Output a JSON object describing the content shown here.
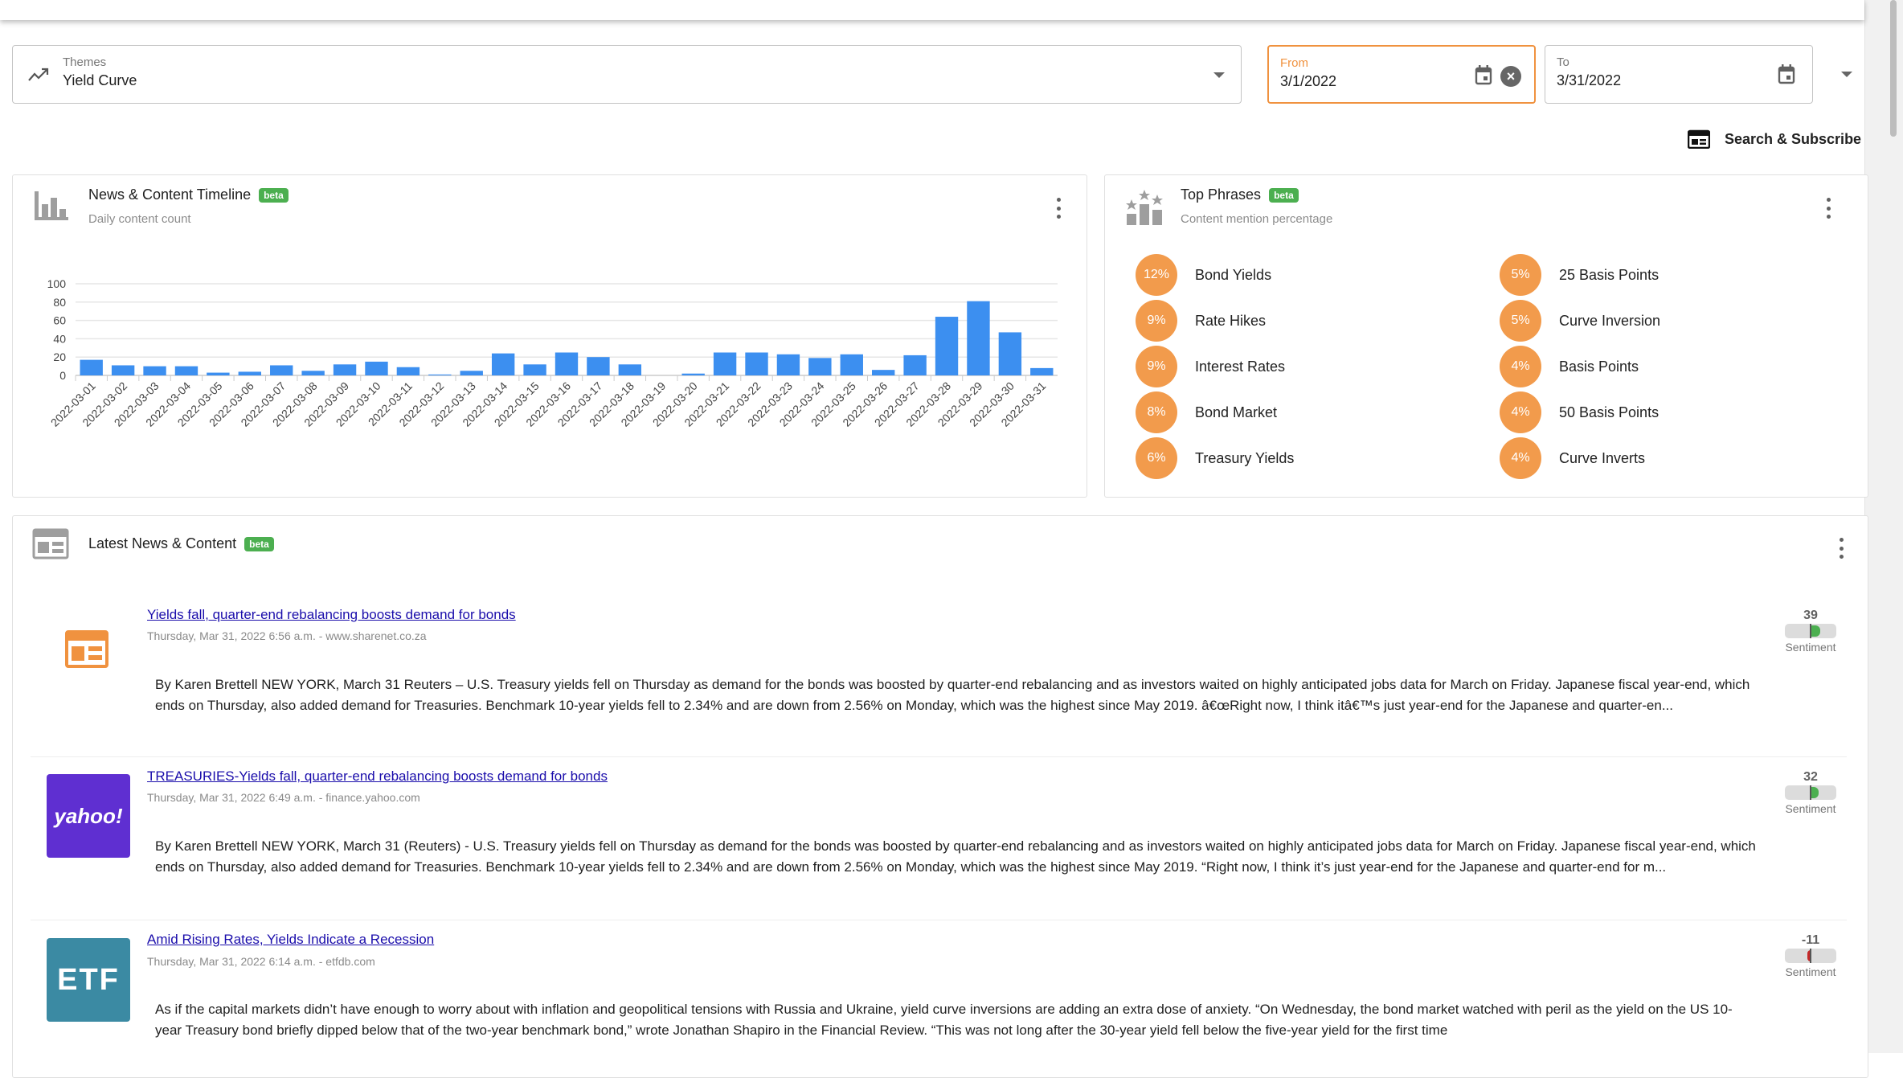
{
  "filters": {
    "themes": {
      "label": "Themes",
      "value": "Yield Curve"
    },
    "from": {
      "label": "From",
      "value": "3/1/2022"
    },
    "to": {
      "label": "To",
      "value": "3/31/2022"
    }
  },
  "search_subscribe_label": "Search & Subscribe",
  "beta_label": "beta",
  "timeline": {
    "title": "News & Content Timeline",
    "subtitle": "Daily content count"
  },
  "chart_data": {
    "type": "bar",
    "title": "News & Content Timeline",
    "subtitle": "Daily content count",
    "xlabel": "",
    "ylabel": "",
    "ylim": [
      0,
      100
    ],
    "yticks": [
      0,
      20,
      40,
      60,
      80,
      100
    ],
    "grid": true,
    "color": "#3c8ff0",
    "categories": [
      "2022-03-01",
      "2022-03-02",
      "2022-03-03",
      "2022-03-04",
      "2022-03-05",
      "2022-03-06",
      "2022-03-07",
      "2022-03-08",
      "2022-03-09",
      "2022-03-10",
      "2022-03-11",
      "2022-03-12",
      "2022-03-13",
      "2022-03-14",
      "2022-03-15",
      "2022-03-16",
      "2022-03-17",
      "2022-03-18",
      "2022-03-19",
      "2022-03-20",
      "2022-03-21",
      "2022-03-22",
      "2022-03-23",
      "2022-03-24",
      "2022-03-25",
      "2022-03-26",
      "2022-03-27",
      "2022-03-28",
      "2022-03-29",
      "2022-03-30",
      "2022-03-31"
    ],
    "values": [
      17,
      11,
      10,
      10,
      3,
      4,
      11,
      5,
      12,
      15,
      9,
      1,
      5,
      24,
      12,
      25,
      20,
      12,
      0,
      2,
      25,
      25,
      23,
      19,
      23,
      6,
      22,
      64,
      81,
      47,
      8
    ]
  },
  "phrases": {
    "title": "Top Phrases",
    "subtitle": "Content mention percentage",
    "left": [
      {
        "pct": "12%",
        "label": "Bond Yields"
      },
      {
        "pct": "9%",
        "label": "Rate Hikes"
      },
      {
        "pct": "9%",
        "label": "Interest Rates"
      },
      {
        "pct": "8%",
        "label": "Bond Market"
      },
      {
        "pct": "6%",
        "label": "Treasury Yields"
      }
    ],
    "right": [
      {
        "pct": "5%",
        "label": "25 Basis Points"
      },
      {
        "pct": "5%",
        "label": "Curve Inversion"
      },
      {
        "pct": "4%",
        "label": "Basis Points"
      },
      {
        "pct": "4%",
        "label": "50 Basis Points"
      },
      {
        "pct": "4%",
        "label": "Curve Inverts"
      }
    ]
  },
  "news": {
    "title": "Latest News & Content",
    "sentiment_label": "Sentiment",
    "items": [
      {
        "title": "Yields fall, quarter-end rebalancing boosts demand for bonds",
        "meta": "Thursday, Mar 31, 2022 6:56 a.m. - www.sharenet.co.za",
        "source_icon": "newspaper-icon",
        "body": "By Karen Brettell NEW YORK, March 31  Reuters  – U.S. Treasury yields fell on Thursday as demand for the bonds was boosted by quarter-end rebalancing and as investors waited on highly anticipated jobs data for March on Friday. Japanese fiscal year-end, which ends on Thursday, also added demand for Treasuries. Benchmark 10-year yields fell to 2.34% and are down from 2.56% on Monday, which was the highest since May 2019. â€œRight now, I think itâ€™s just year-end for the Japanese and quarter-en...",
        "sentiment": 39
      },
      {
        "title": "TREASURIES-Yields fall, quarter-end rebalancing boosts demand for bonds",
        "meta": "Thursday, Mar 31, 2022 6:49 a.m. - finance.yahoo.com",
        "source_logo_text": "yahoo!",
        "body": "By Karen Brettell NEW YORK, March 31 (Reuters) - U.S. Treasury yields fell on Thursday as demand for the bonds was boosted by quarter-end rebalancing and as investors waited on highly anticipated jobs data for March on Friday. Japanese fiscal year-end, which ends on Thursday, also added demand for Treasuries. Benchmark 10-year yields fell to 2.34% and are down from 2.56% on Monday, which was the highest since May 2019. “Right now, I think it’s just year-end for the Japanese and quarter-end for m...",
        "sentiment": 32
      },
      {
        "title": "Amid Rising Rates, Yields Indicate a Recession",
        "meta": "Thursday, Mar 31, 2022 6:14 a.m. - etfdb.com",
        "source_logo_text": "ETF",
        "body": "As if the capital markets didn’t have enough to worry about with inflation and geopolitical tensions with Russia and Ukraine, yield curve inversions are adding an extra dose of anxiety. “On Wednesday, the bond market watched with peril as the yield on the US 10-year Treasury bond briefly dipped below that of the two-year benchmark bond,” wrote Jonathan Shapiro in the Financial Review. “This was not long after the 30-year yield fell below the five-year yield for the first time",
        "sentiment": -11
      }
    ]
  },
  "colors": {
    "accent_orange": "#f0923f",
    "phrase_badge": "#f29b4c",
    "bar_blue": "#3c8ff0",
    "beta_green": "#4caf50",
    "link": "#1a0dab",
    "sentiment_positive": "#4caf50",
    "sentiment_negative": "#c62828",
    "yahoo_purple": "#5f2fd1",
    "etf_teal": "#3b8aa3"
  }
}
